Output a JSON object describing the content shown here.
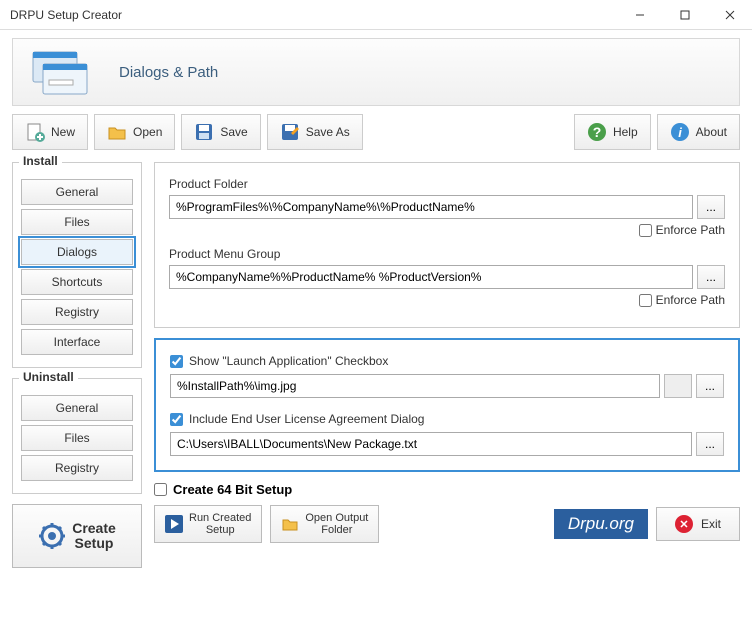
{
  "window": {
    "title": "DRPU Setup Creator"
  },
  "header": {
    "section_title": "Dialogs & Path"
  },
  "toolbar": {
    "new": "New",
    "open": "Open",
    "save": "Save",
    "save_as": "Save As",
    "help": "Help",
    "about": "About"
  },
  "sidebar": {
    "install_label": "Install",
    "install_items": [
      "General",
      "Files",
      "Dialogs",
      "Shortcuts",
      "Registry",
      "Interface"
    ],
    "install_active": 2,
    "uninstall_label": "Uninstall",
    "uninstall_items": [
      "General",
      "Files",
      "Registry"
    ],
    "create_setup": "Create\nSetup"
  },
  "paths": {
    "product_folder_label": "Product Folder",
    "product_folder_value": "%ProgramFiles%\\%CompanyName%\\%ProductName%",
    "enforce1": "Enforce Path",
    "product_menu_label": "Product Menu Group",
    "product_menu_value": "%CompanyName%%ProductName% %ProductVersion%",
    "enforce2": "Enforce Path"
  },
  "dialogs": {
    "show_launch_label": "Show \"Launch Application\" Checkbox",
    "launch_path": "%InstallPath%\\img.jpg",
    "eula_label": "Include End User License Agreement Dialog",
    "eula_path": "C:\\Users\\IBALL\\Documents\\New Package.txt"
  },
  "bottom": {
    "bit64": "Create 64 Bit Setup",
    "run_created": "Run Created\nSetup",
    "open_output": "Open Output\nFolder",
    "exit": "Exit",
    "watermark": "Drpu.org"
  }
}
